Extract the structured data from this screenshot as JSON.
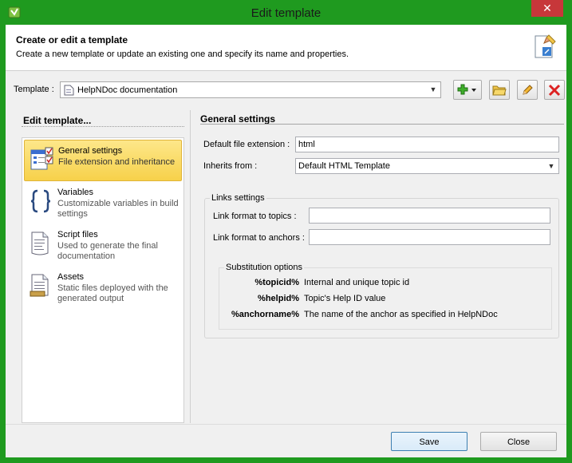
{
  "window": {
    "title": "Edit template",
    "close_glyph": "✕"
  },
  "header": {
    "title": "Create or edit a template",
    "description": "Create a new template or update an existing one and specify its name and properties."
  },
  "template_row": {
    "label": "Template :",
    "selected": "HelpNDoc documentation",
    "buttons": [
      "add-template",
      "open-template-folder",
      "rename-template",
      "delete-template"
    ]
  },
  "left_panel": {
    "title": "Edit template...",
    "items": [
      {
        "name": "General settings",
        "desc": "File extension and inheritance",
        "icon": "settings-window-icon",
        "selected": true
      },
      {
        "name": "Variables",
        "desc": "Customizable variables in build settings",
        "icon": "braces-icon",
        "selected": false
      },
      {
        "name": "Script files",
        "desc": "Used to generate the final documentation",
        "icon": "script-file-icon",
        "selected": false
      },
      {
        "name": "Assets",
        "desc": "Static files deployed with the generated output",
        "icon": "assets-icon",
        "selected": false
      }
    ]
  },
  "general": {
    "title": "General settings",
    "ext_label": "Default file extension :",
    "ext_value": "html",
    "inherits_label": "Inherits from :",
    "inherits_value": "Default HTML Template",
    "links": {
      "caption": "Links settings",
      "topics_label": "Link format to topics :",
      "topics_value": "",
      "anchors_label": "Link format to anchors :",
      "anchors_value": ""
    },
    "substitution": {
      "caption": "Substitution options",
      "rows": [
        {
          "code": "%topicid%",
          "desc": "Internal and unique topic id"
        },
        {
          "code": "%helpid%",
          "desc": "Topic's Help ID value"
        },
        {
          "code": "%anchorname%",
          "desc": "The name of the anchor as specified in HelpNDoc"
        }
      ]
    }
  },
  "footer": {
    "save": "Save",
    "close": "Close"
  },
  "colors": {
    "frame": "#1f9a1f",
    "selection": "#f7d14a",
    "close": "#c7373a"
  }
}
